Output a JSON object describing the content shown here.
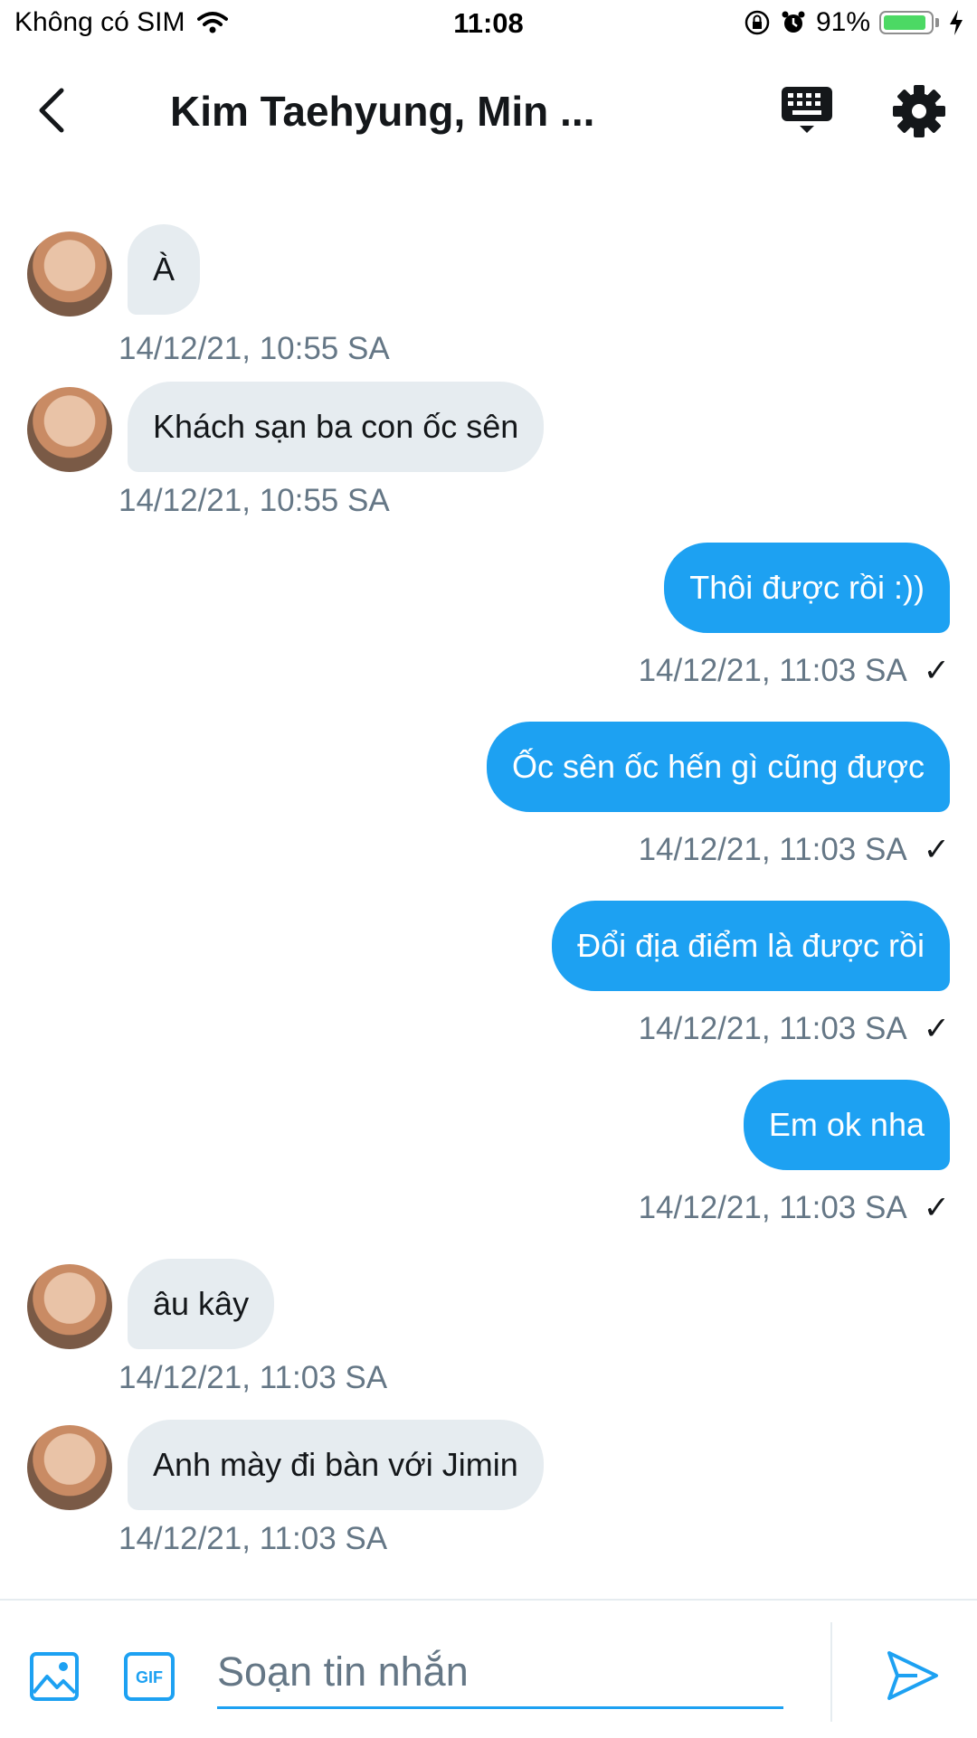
{
  "status_bar": {
    "carrier": "Không có SIM",
    "time": "11:08",
    "battery": "91%",
    "battery_level": 0.91,
    "icons": [
      "wifi-icon",
      "rotation-lock-icon",
      "alarm-icon",
      "battery-icon",
      "charging-icon"
    ]
  },
  "header": {
    "title": "Kim Taehyung, Min ...",
    "icons": [
      "back-icon",
      "keyboard-icon",
      "gear-icon"
    ]
  },
  "messages": [
    {
      "direction": "in",
      "text": "À",
      "time": "14/12/21, 10:55 SA"
    },
    {
      "direction": "in",
      "text": "Khách sạn ba con ốc sên",
      "time": "14/12/21, 10:55 SA"
    },
    {
      "direction": "out",
      "text": "Thôi được rồi :))",
      "time": "14/12/21, 11:03 SA",
      "status": "✓"
    },
    {
      "direction": "out",
      "text": "Ốc sên ốc hến gì cũng được",
      "time": "14/12/21, 11:03 SA",
      "status": "✓"
    },
    {
      "direction": "out",
      "text": "Đổi địa điểm là được rồi",
      "time": "14/12/21, 11:03 SA",
      "status": "✓"
    },
    {
      "direction": "out",
      "text": "Em ok nha",
      "time": "14/12/21, 11:03 SA",
      "status": "✓"
    },
    {
      "direction": "in",
      "text": "âu kây",
      "time": "14/12/21, 11:03 SA"
    },
    {
      "direction": "in",
      "text": "Anh mày đi bàn với Jimin",
      "time": "14/12/21, 11:03 SA"
    }
  ],
  "composer": {
    "placeholder": "Soạn tin nhắn",
    "gif_label": "GIF",
    "icons": [
      "image-icon",
      "gif-icon",
      "send-icon"
    ]
  },
  "colors": {
    "accent": "#1da1f2",
    "incoming_bubble": "#e6ecf0",
    "secondary_text": "#657786",
    "battery_green": "#4cd964"
  }
}
